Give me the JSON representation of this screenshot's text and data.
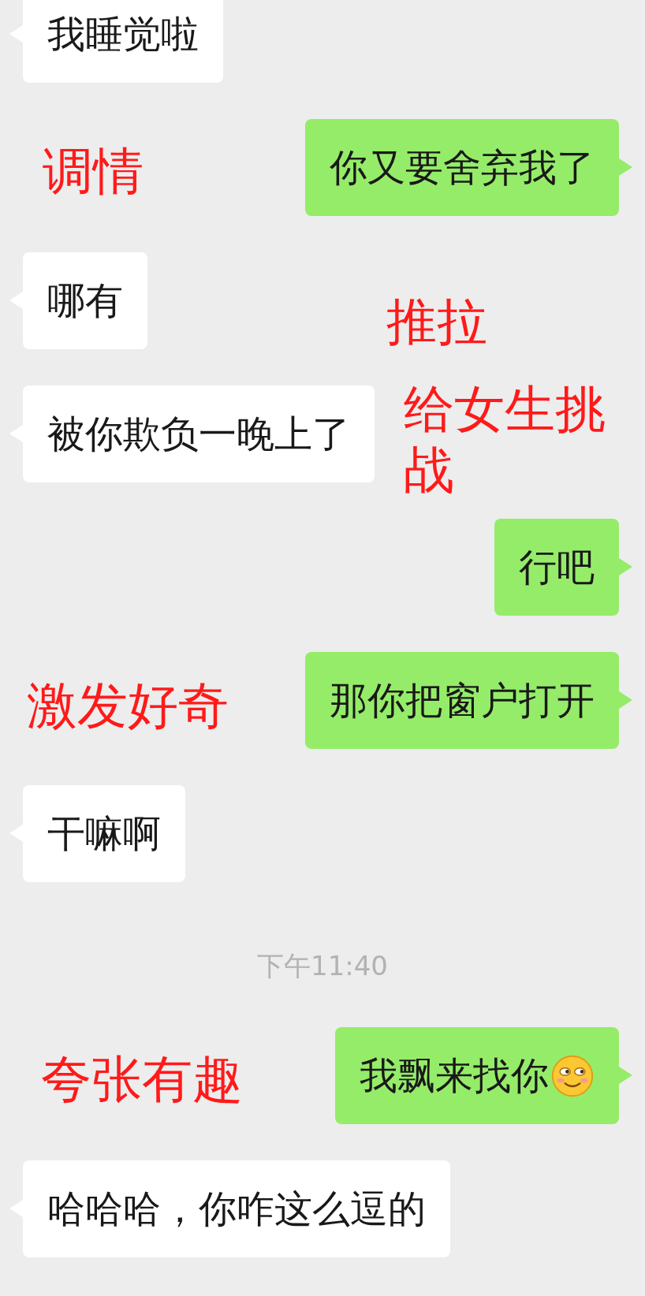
{
  "items": [
    {
      "kind": "message",
      "outgoing": false,
      "text": "我睡觉啦"
    },
    {
      "kind": "message",
      "outgoing": true,
      "text": "你又要舍弃我了",
      "annotation": "调情"
    },
    {
      "kind": "message",
      "outgoing": false,
      "text": "哪有",
      "annotation": "推拉"
    },
    {
      "kind": "message",
      "outgoing": false,
      "text": "被你欺负一晚上了",
      "annotation": "给女生挑战"
    },
    {
      "kind": "message",
      "outgoing": true,
      "text": "行吧"
    },
    {
      "kind": "message",
      "outgoing": true,
      "text": "那你把窗户打开",
      "annotation": "激发好奇"
    },
    {
      "kind": "message",
      "outgoing": false,
      "text": "干嘛啊"
    },
    {
      "kind": "time",
      "text": "下午11:40"
    },
    {
      "kind": "message",
      "outgoing": true,
      "text": "我飘来找你",
      "emoji": true,
      "annotation": "夸张有趣"
    },
    {
      "kind": "message",
      "outgoing": false,
      "text": "哈哈哈，你咋这么逗的"
    }
  ]
}
